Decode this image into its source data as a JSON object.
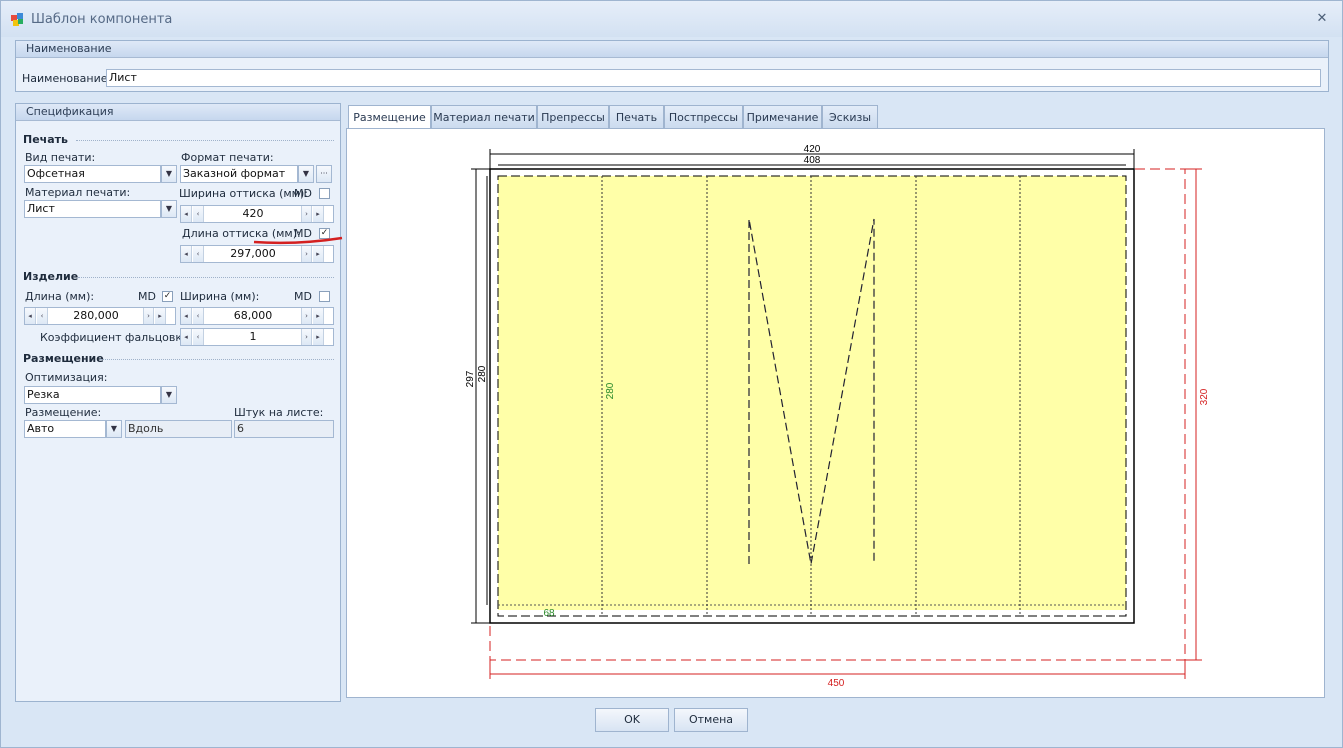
{
  "window": {
    "title": "Шаблон компонента",
    "close": "✕"
  },
  "name_group": {
    "header": "Наименование",
    "label": "Наименование:",
    "value": "Лист"
  },
  "spec": {
    "header": "Спецификация",
    "print": {
      "section": "Печать",
      "print_type_label": "Вид печати:",
      "print_type_value": "Офсетная",
      "format_label": "Формат печати:",
      "format_value": "Заказной формат",
      "material_label": "Материал печати:",
      "material_value": "Лист",
      "width_label": "Ширина оттиска (мм):",
      "width_md": "MD",
      "width_md_checked": false,
      "width_value": "420",
      "length_label": "Длина оттиска (мм):",
      "length_md": "MD",
      "length_md_checked": true,
      "length_value": "297,000"
    },
    "product": {
      "section": "Изделие",
      "length_label": "Длина (мм):",
      "length_md": "MD",
      "length_md_checked": true,
      "length_value": "280,000",
      "width_label": "Ширина (мм):",
      "width_md": "MD",
      "width_md_checked": false,
      "width_value": "68,000",
      "fold_label": "Коэффициент фальцовки:",
      "fold_value": "1"
    },
    "placement": {
      "section": "Размещение",
      "optimization_label": "Оптимизация:",
      "optimization_value": "Резка",
      "placement_label": "Размещение:",
      "placement_value": "Авто",
      "direction_value": "Вдоль",
      "per_sheet_label": "Штук на листе:",
      "per_sheet_value": "6"
    }
  },
  "tabs": [
    "Размещение",
    "Материал печати",
    "Препрессы",
    "Печать",
    "Постпрессы",
    "Примечание",
    "Эскизы"
  ],
  "drawing": {
    "dim_top_outer": "420",
    "dim_top_inner": "408",
    "dim_left_outer": "297",
    "dim_left_inner": "280",
    "dim_item_height": "280",
    "dim_item_width": "68",
    "dim_right_red": "320",
    "dim_bottom_red": "450",
    "accent_red": "#d42020",
    "accent_green": "#2a8a2a",
    "fill_yellow": "#ffffa8"
  },
  "buttons": {
    "ok": "OK",
    "cancel": "Отмена"
  }
}
